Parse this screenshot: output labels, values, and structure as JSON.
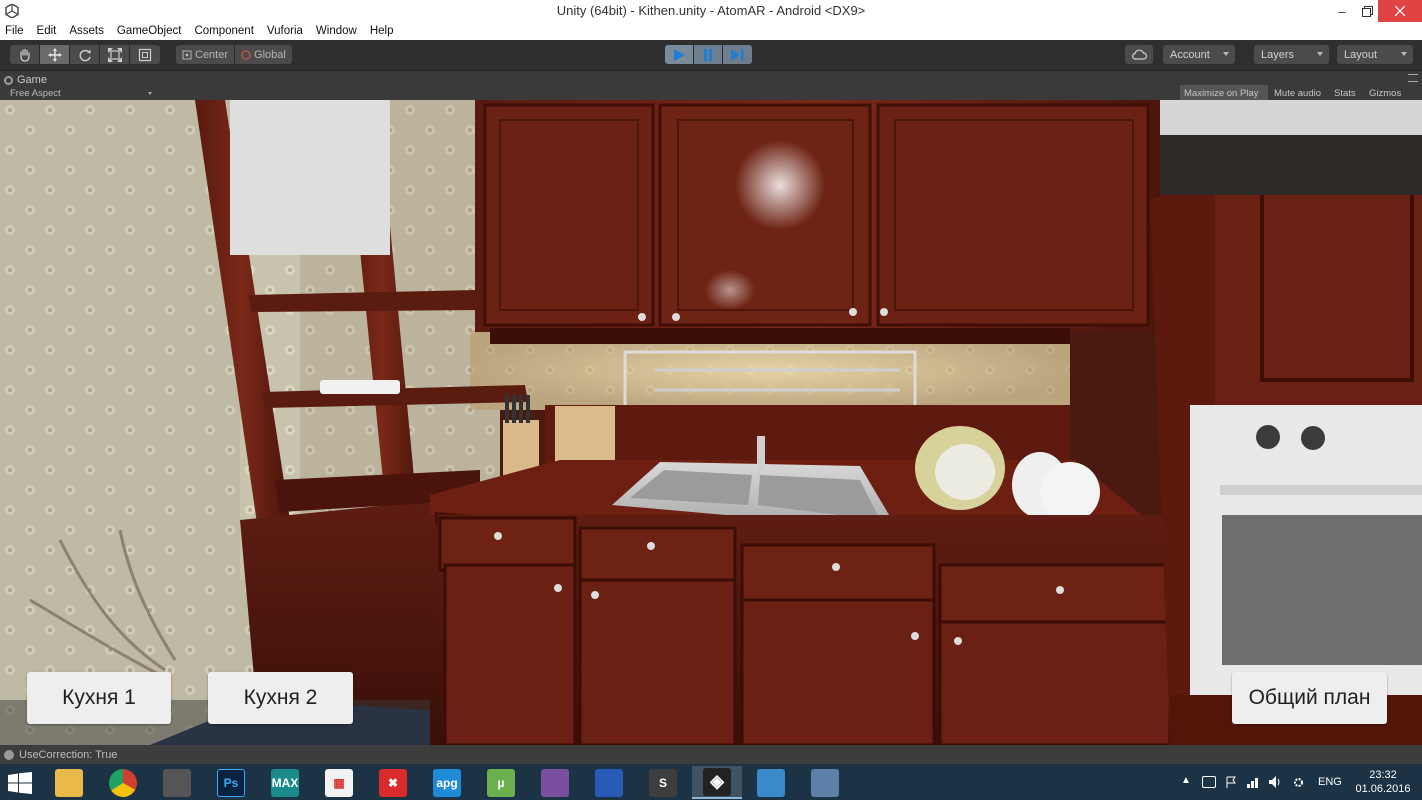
{
  "window": {
    "title": "Unity (64bit) - Kithen.unity - AtomAR - Android <DX9>"
  },
  "menu": [
    "File",
    "Edit",
    "Assets",
    "GameObject",
    "Component",
    "Vuforia",
    "Window",
    "Help"
  ],
  "toolbar": {
    "pivot_center": "Center",
    "pivot_global": "Global",
    "account": "Account",
    "layers": "Layers",
    "layout": "Layout"
  },
  "game_panel": {
    "tab": "Game",
    "aspect": "Free Aspect",
    "maximize": "Maximize on Play",
    "mute": "Mute audio",
    "stats": "Stats",
    "gizmos": "Gizmos"
  },
  "hud": {
    "kitchen1": "Кухня 1",
    "kitchen2": "Кухня 2",
    "overview": "Общий план"
  },
  "status": {
    "message": "UseCorrection: True"
  },
  "taskbar": {
    "apps": [
      {
        "name": "file-explorer",
        "label": "",
        "color": "#e9b949"
      },
      {
        "name": "chrome",
        "label": "",
        "color": "#d23f31"
      },
      {
        "name": "app-dark",
        "label": "",
        "color": "#555555"
      },
      {
        "name": "photoshop",
        "label": "Ps",
        "color": "#0b2140"
      },
      {
        "name": "3ds-max",
        "label": "MAX",
        "color": "#1b8a8a"
      },
      {
        "name": "app-grid",
        "label": "",
        "color": "#f2f2f2"
      },
      {
        "name": "xmind",
        "label": "✖",
        "color": "#d92b2b"
      },
      {
        "name": "apg",
        "label": "apg",
        "color": "#1f8ad6"
      },
      {
        "name": "utorrent",
        "label": "µ",
        "color": "#6ab04c"
      },
      {
        "name": "winrar",
        "label": "",
        "color": "#7a4fa0"
      },
      {
        "name": "save-app",
        "label": "",
        "color": "#2a5ab8"
      },
      {
        "name": "sublime",
        "label": "S",
        "color": "#3d3d3d"
      },
      {
        "name": "unity",
        "label": "",
        "color": "#222222"
      },
      {
        "name": "photos",
        "label": "",
        "color": "#3a89c9"
      },
      {
        "name": "teamviewer",
        "label": "",
        "color": "#5d7fa8"
      }
    ],
    "active_app": 12,
    "language": "ENG",
    "time": "23:32",
    "date": "01.06.2016"
  }
}
